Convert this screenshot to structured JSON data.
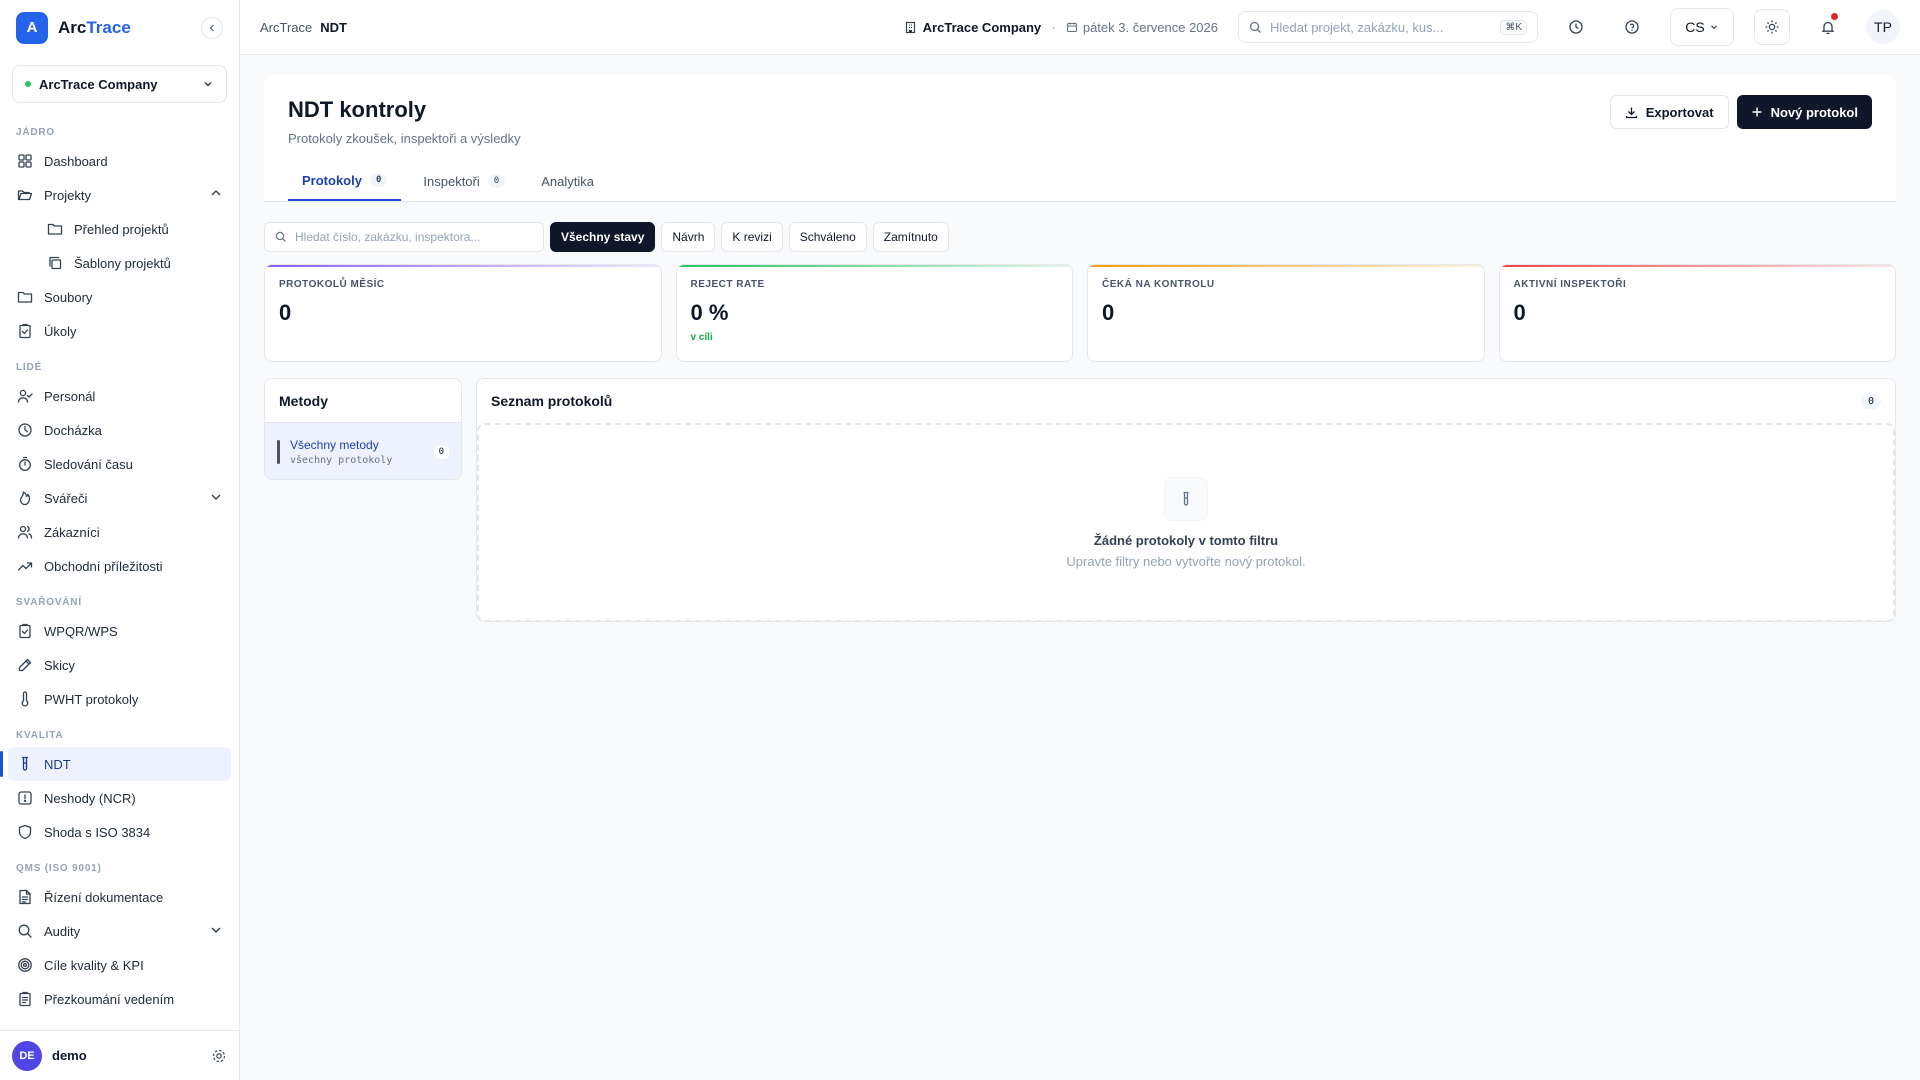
{
  "brand": {
    "logo": "A",
    "name_a": "Arc",
    "name_b": "Trace"
  },
  "company": {
    "name": "ArcTrace Company"
  },
  "sidebar": {
    "sections": [
      {
        "title": "JÁDRO",
        "items": [
          {
            "label": "Dashboard",
            "icon": "grid-icon"
          },
          {
            "label": "Projekty",
            "icon": "folder-open-icon",
            "chevron": "up"
          },
          {
            "label": "Přehled projektů",
            "icon": "folder-icon",
            "sub": true
          },
          {
            "label": "Šablony projektů",
            "icon": "copy-icon",
            "sub": true
          },
          {
            "label": "Soubory",
            "icon": "folder-icon"
          },
          {
            "label": "Úkoly",
            "icon": "clipboard-check-icon"
          }
        ]
      },
      {
        "title": "LIDÉ",
        "items": [
          {
            "label": "Personál",
            "icon": "user-check-icon"
          },
          {
            "label": "Docházka",
            "icon": "clock-icon"
          },
          {
            "label": "Sledování času",
            "icon": "timer-icon"
          },
          {
            "label": "Svářeči",
            "icon": "flame-icon",
            "chevron": "down"
          },
          {
            "label": "Zákazníci",
            "icon": "users-icon"
          },
          {
            "label": "Obchodní příležitosti",
            "icon": "trending-up-icon"
          }
        ]
      },
      {
        "title": "SVAŘOVÁNÍ",
        "items": [
          {
            "label": "WPQR/WPS",
            "icon": "clipboard-check-icon"
          },
          {
            "label": "Skicy",
            "icon": "pen-icon"
          },
          {
            "label": "PWHT protokoly",
            "icon": "thermometer-icon"
          }
        ]
      },
      {
        "title": "KVALITA",
        "items": [
          {
            "label": "NDT",
            "icon": "test-tube-icon",
            "active": true
          },
          {
            "label": "Neshody (NCR)",
            "icon": "alert-icon"
          },
          {
            "label": "Shoda s ISO 3834",
            "icon": "shield-icon"
          }
        ]
      },
      {
        "title": "QMS (ISO 9001)",
        "items": [
          {
            "label": "Řízení dokumentace",
            "icon": "file-text-icon"
          },
          {
            "label": "Audity",
            "icon": "search-icon",
            "chevron": "down"
          },
          {
            "label": "Cíle kvality & KPI",
            "icon": "target-icon"
          },
          {
            "label": "Přezkoumání vedením",
            "icon": "clipboard-list-icon"
          }
        ]
      }
    ]
  },
  "user": {
    "initials": "DE",
    "name": "demo"
  },
  "topbar": {
    "crumb1": "ArcTrace",
    "crumb2": "NDT",
    "company": "ArcTrace Company",
    "sep": "·",
    "date": "pátek 3. července 2026",
    "search_placeholder": "Hledat projekt, zakázku, kus...",
    "kbd": "⌘K",
    "lang": "CS",
    "avatar": "TP"
  },
  "page": {
    "title": "NDT kontroly",
    "subtitle": "Protokoly zkoušek, inspektoři a výsledky",
    "export_label": "Exportovat",
    "new_label": "Nový protokol",
    "tabs": [
      {
        "label": "Protokoly",
        "badge": "0"
      },
      {
        "label": "Inspektoři",
        "badge": "0"
      },
      {
        "label": "Analytika"
      }
    ]
  },
  "filters": {
    "search_placeholder": "Hledat číslo, zakázku, inspektora...",
    "chips": [
      "Všechny stavy",
      "Návrh",
      "K revizi",
      "Schváleno",
      "Zamítnuto"
    ]
  },
  "stats": [
    {
      "label": "PROTOKOLŮ MĚSÍC",
      "value": "0",
      "color": "#8b5cf6"
    },
    {
      "label": "REJECT RATE",
      "value": "0 %",
      "note": "v cíli",
      "color": "#22c55e"
    },
    {
      "label": "ČEKÁ NA KONTROLU",
      "value": "0",
      "color": "#f59e0b"
    },
    {
      "label": "AKTIVNÍ INSPEKTOŘI",
      "value": "0",
      "color": "#ef4444"
    }
  ],
  "methods": {
    "title": "Metody",
    "item_title": "Všechny metody",
    "item_sub": "všechny protokoly",
    "item_badge": "0"
  },
  "protocols": {
    "title": "Seznam protokolů",
    "count": "0",
    "empty_title": "Žádné protokoly v tomto filtru",
    "empty_sub": "Upravte filtry nebo vytvořte nový protokol."
  }
}
